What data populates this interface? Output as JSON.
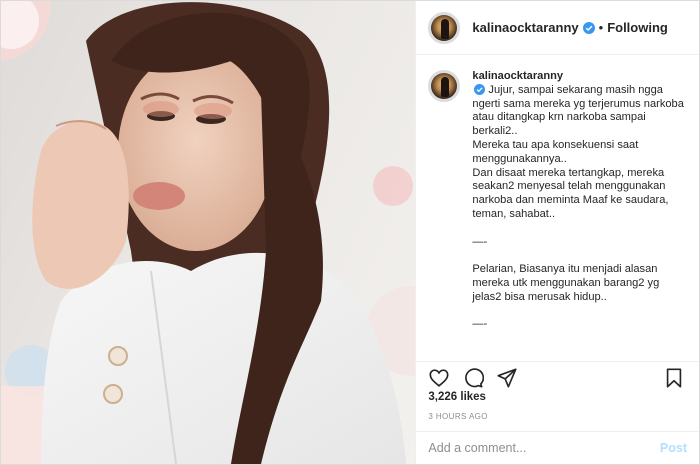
{
  "header": {
    "username": "kalinaocktaranny",
    "separator": "•",
    "follow_state": "Following"
  },
  "caption": {
    "username": "kalinaocktaranny",
    "text": "Jujur, sampai sekarang masih ngga ngerti sama mereka yg terjerumus narkoba atau ditangkap krn narkoba sampai berkali2..\nMereka tau apa konsekuensi saat menggunakannya..\nDan disaat mereka tertangkap, mereka seakan2 menyesal telah menggunakan narkoba dan meminta Maaf ke saudara, teman, sahabat..\n\n—-\n\nPelarian, Biasanya itu menjadi alasan mereka utk menggunakan barang2 yg jelas2 bisa merusak hidup..\n\n—-"
  },
  "stats": {
    "likes": "3,226 likes",
    "timestamp": "3 HOURS AGO"
  },
  "comment": {
    "placeholder": "Add a comment...",
    "post_label": "Post"
  },
  "colors": {
    "verified_blue": "#3897f0",
    "post_disabled": "#b2dffc",
    "muted_text": "#8e8e8e"
  },
  "icons": {
    "like": "heart-icon",
    "comment": "comment-icon",
    "share": "share-icon",
    "save": "bookmark-icon"
  }
}
